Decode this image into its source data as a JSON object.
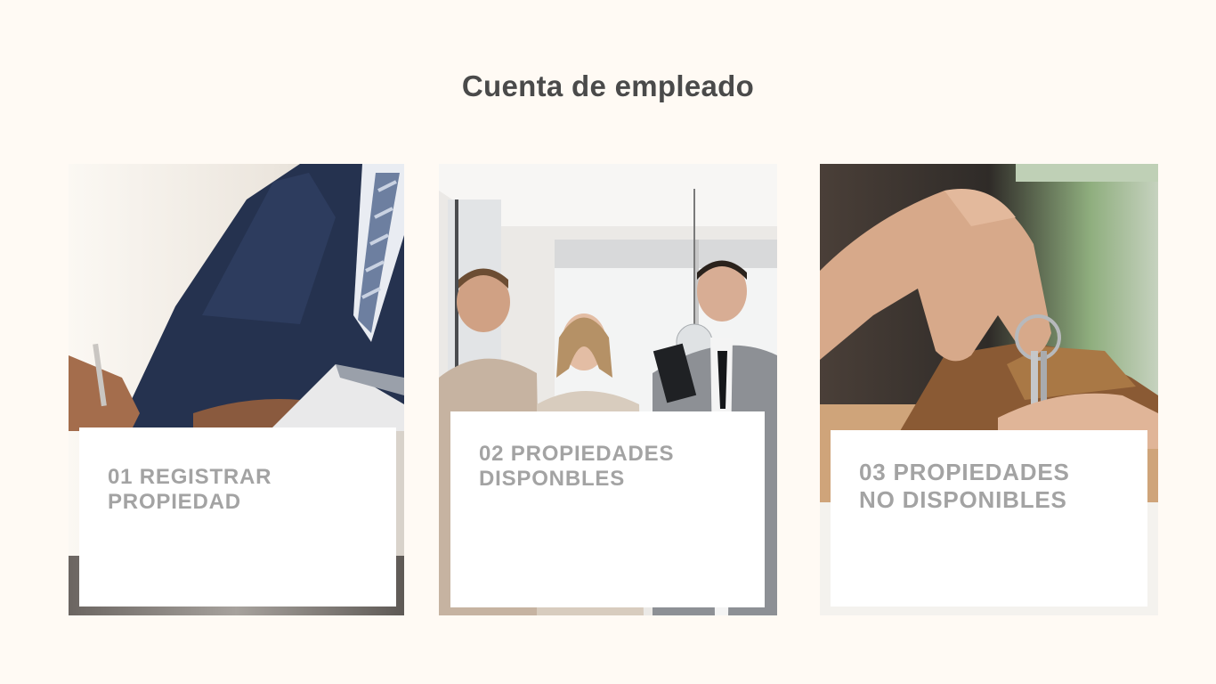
{
  "page": {
    "title": "Cuenta de empleado",
    "background": "#fffaf4"
  },
  "cards": [
    {
      "number": "01",
      "line1": "01 REGISTRAR",
      "line2": "PROPIEDAD",
      "image_icon": "businessman-signing-contract-house-model-photo"
    },
    {
      "number": "02",
      "line1": "02 PROPIEDADES",
      "line2": "DISPONBLES",
      "image_icon": "couple-with-real-estate-agent-photo"
    },
    {
      "number": "03",
      "line1": "03 PROPIEDADES",
      "line2": "NO DISPONIBLES",
      "image_icon": "hand-holding-house-keys-photo"
    }
  ],
  "colors": {
    "title": "#4a4a4a",
    "label": "#a3a3a3",
    "panel": "#ffffff"
  }
}
